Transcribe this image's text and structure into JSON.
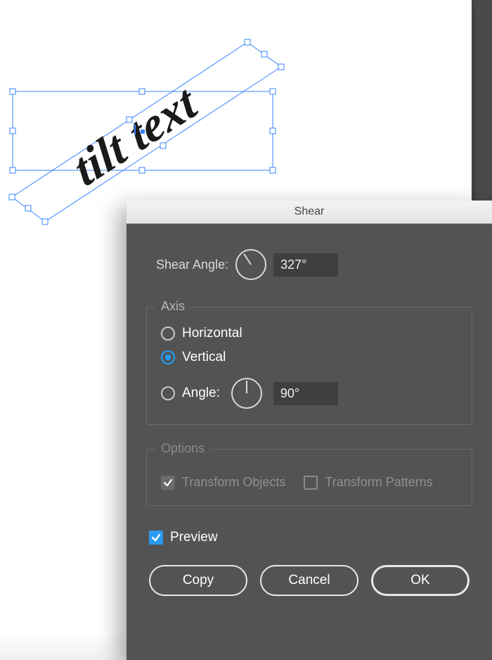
{
  "dialog": {
    "title": "Shear",
    "shear_angle_label": "Shear Angle:",
    "shear_angle_value": "327°",
    "shear_angle_deg": 327,
    "axis_group_label": "Axis",
    "axis": {
      "horizontal_label": "Horizontal",
      "vertical_label": "Vertical",
      "angle_label": "Angle:",
      "angle_value": "90°",
      "angle_deg": 90,
      "selected": "vertical"
    },
    "options_group_label": "Options",
    "options": {
      "transform_objects_label": "Transform Objects",
      "transform_objects_checked": true,
      "transform_objects_enabled": false,
      "transform_patterns_label": "Transform Patterns",
      "transform_patterns_checked": false,
      "transform_patterns_enabled": false
    },
    "preview_label": "Preview",
    "preview_checked": true,
    "buttons": {
      "copy": "Copy",
      "cancel": "Cancel",
      "ok": "OK"
    }
  },
  "canvas": {
    "text": "tilt text"
  }
}
